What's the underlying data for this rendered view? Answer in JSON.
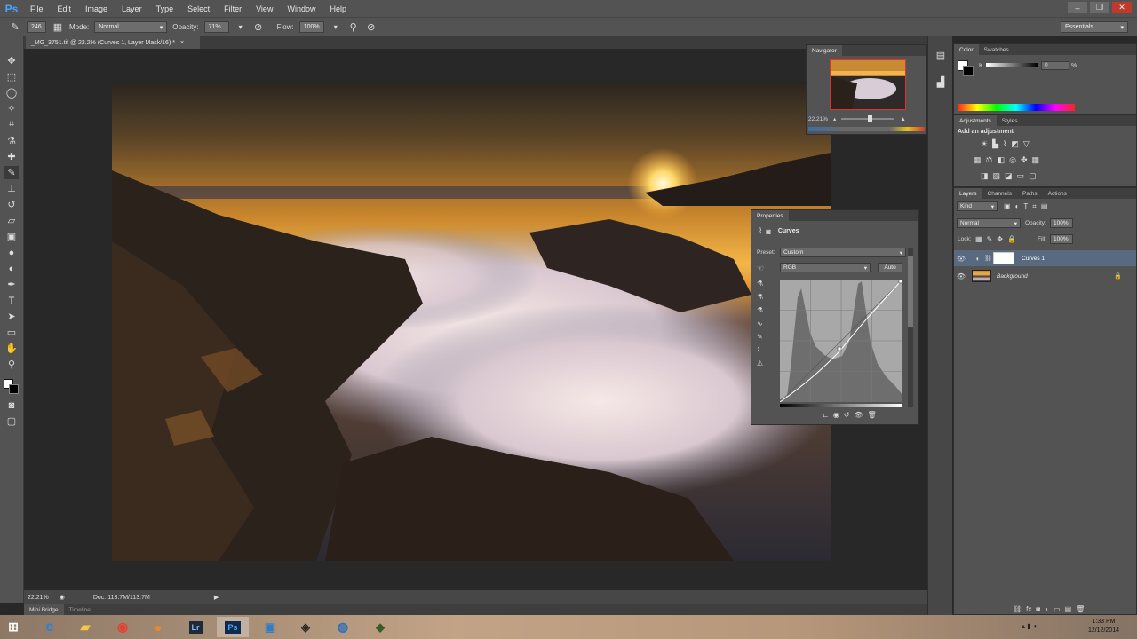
{
  "app": {
    "logo": "Ps"
  },
  "menu": [
    "File",
    "Edit",
    "Image",
    "Layer",
    "Type",
    "Select",
    "Filter",
    "View",
    "Window",
    "Help"
  ],
  "window_controls": {
    "minimize": "–",
    "restore": "❐",
    "close": "✕"
  },
  "options": {
    "brush_size": "246",
    "mode_label": "Mode:",
    "mode_value": "Normal",
    "opacity_label": "Opacity:",
    "opacity_value": "71%",
    "flow_label": "Flow:",
    "flow_value": "100%",
    "workspace": "Essentials"
  },
  "document": {
    "tab_title": "_MG_3751.tif @ 22.2% (Curves 1, Layer Mask/16) *",
    "tab_close": "×"
  },
  "status": {
    "zoom": "22.21%",
    "doc": "Doc: 113.7M/113.7M"
  },
  "bottom_tabs": [
    "Mini Bridge",
    "Timeline"
  ],
  "navigator": {
    "title": "Navigator",
    "zoom": "22.21%"
  },
  "color_panel": {
    "tabs": [
      "Color",
      "Swatches"
    ],
    "channel": "K",
    "value": "0",
    "unit": "%"
  },
  "adjustments_panel": {
    "tabs": [
      "Adjustments",
      "Styles"
    ],
    "heading": "Add an adjustment"
  },
  "layers_panel": {
    "tabs": [
      "Layers",
      "Channels",
      "Paths",
      "Actions"
    ],
    "kind": "Kind",
    "blend_mode": "Normal",
    "opacity_label": "Opacity:",
    "opacity_value": "100%",
    "lock_label": "Lock:",
    "fill_label": "Fill:",
    "fill_value": "100%",
    "layers": [
      {
        "name": "Curves 1",
        "selected": true
      },
      {
        "name": "Background",
        "selected": false
      }
    ]
  },
  "properties_panel": {
    "title": "Properties",
    "heading": "Curves",
    "preset_label": "Preset:",
    "preset_value": "Custom",
    "channel_value": "RGB",
    "auto_label": "Auto"
  },
  "taskbar": {
    "apps": [
      "start",
      "ie",
      "explorer",
      "chrome",
      "firefox",
      "lightroom",
      "photoshop",
      "monitor",
      "app8",
      "firefox2",
      "app10"
    ],
    "lr_label": "Lr",
    "ps_label": "Ps",
    "time": "1:33 PM",
    "date": "12/12/2014"
  },
  "colors": {
    "accent": "#4aa3ff",
    "selected_layer": "#596a80"
  }
}
